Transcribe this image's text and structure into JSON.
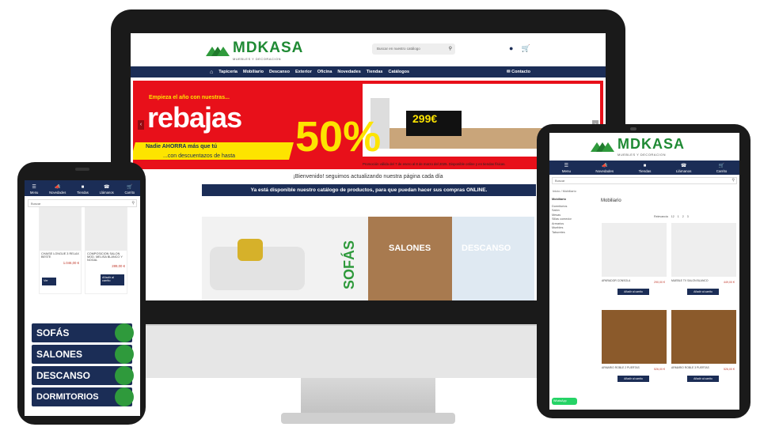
{
  "brand": {
    "name": "MDKASA",
    "tagline": "MUEBLES Y DECORACION",
    "green": "#2f9a3c",
    "navy": "#1b2d56",
    "red": "#e8101a",
    "yellow": "#fde400"
  },
  "desktop": {
    "search_placeholder": "Buscar en nuestro catálogo",
    "nav": [
      "Tapicería",
      "Mobiliario",
      "Descanso",
      "Exterior",
      "Oficina",
      "Novedades",
      "Tiendas",
      "Catálogos"
    ],
    "contact": "Contacto",
    "banner": {
      "kicker": "Empieza el año con nuestras...",
      "headline": "rebajas",
      "tag": "Nadie AHORRA más que tú",
      "sub": "...con descuentazos de hasta",
      "pct": "50%",
      "price": "299€",
      "foot": "Promoción válida del 7 de enero al 8 de marzo del 2025. Disponible online y en tiendas físicas."
    },
    "welcome": "¡Bienvenido! seguimos actualizando nuestra página cada día",
    "catalog": "Ya está disponible nuestro catálogo de productos, para que puedan hacer sus compras ONLINE.",
    "tiles": {
      "sofas": "SOFÁS",
      "salones": "SALONES",
      "descanso": "DESCANSO"
    }
  },
  "phone": {
    "nav": [
      {
        "icon": "menu-icon",
        "label": "Menu"
      },
      {
        "icon": "megaphone-icon",
        "label": "Novedades"
      },
      {
        "icon": "store-icon",
        "label": "Tiendas"
      },
      {
        "icon": "phone-icon",
        "label": "Llámanos"
      },
      {
        "icon": "cart-icon",
        "label": "Carrito"
      }
    ],
    "search_placeholder": "Buscar",
    "products": [
      {
        "title": "CHAISE LONGUE 3 RELAX BESTE",
        "price": "1.046,00 €",
        "button": "Ver"
      },
      {
        "title": "COMPOSICION SALON MOD. MELISA BLANCO Y NOGAL",
        "price": "289,00 €",
        "button": "Añadir al carrito"
      }
    ],
    "categories": [
      "SOFÁS",
      "SALONES",
      "DESCANSO",
      "DORMITORIOS"
    ]
  },
  "tablet": {
    "nav": [
      {
        "icon": "menu-icon",
        "label": "Menu"
      },
      {
        "icon": "megaphone-icon",
        "label": "Novedades"
      },
      {
        "icon": "store-icon",
        "label": "Tiendas"
      },
      {
        "icon": "phone-icon",
        "label": "Llámanos"
      },
      {
        "icon": "cart-icon",
        "label": "Carrito"
      }
    ],
    "search_placeholder": "Buscar",
    "breadcrumb": "Inicio  /  Mobiliario",
    "side_heading": "Mobiliario",
    "side_items": [
      "Dormitorios",
      "Salón",
      "Mesas",
      "Sillas comedor",
      "Armarios",
      "Muebles",
      "Taburetes"
    ],
    "title": "Mobiliario",
    "sort": [
      "Relevancia",
      "12",
      "1",
      "2",
      "3"
    ],
    "products": [
      {
        "title": "APARADOR CONSOLA",
        "price": "290,00 €",
        "button": "Añadir al carrito"
      },
      {
        "title": "MUEBLE TV SALON BLANCO",
        "price": "449,00 €",
        "button": "Añadir al carrito"
      },
      {
        "title": "ARMARIO ROBLE 2 PUERTAS",
        "price": "526,00 €",
        "button": "Añadir al carrito"
      },
      {
        "title": "ARMARIO ROBLE 3 PUERTAS",
        "price": "526,00 €",
        "button": "Añadir al carrito"
      }
    ],
    "whatsapp": "WhatsApp"
  }
}
